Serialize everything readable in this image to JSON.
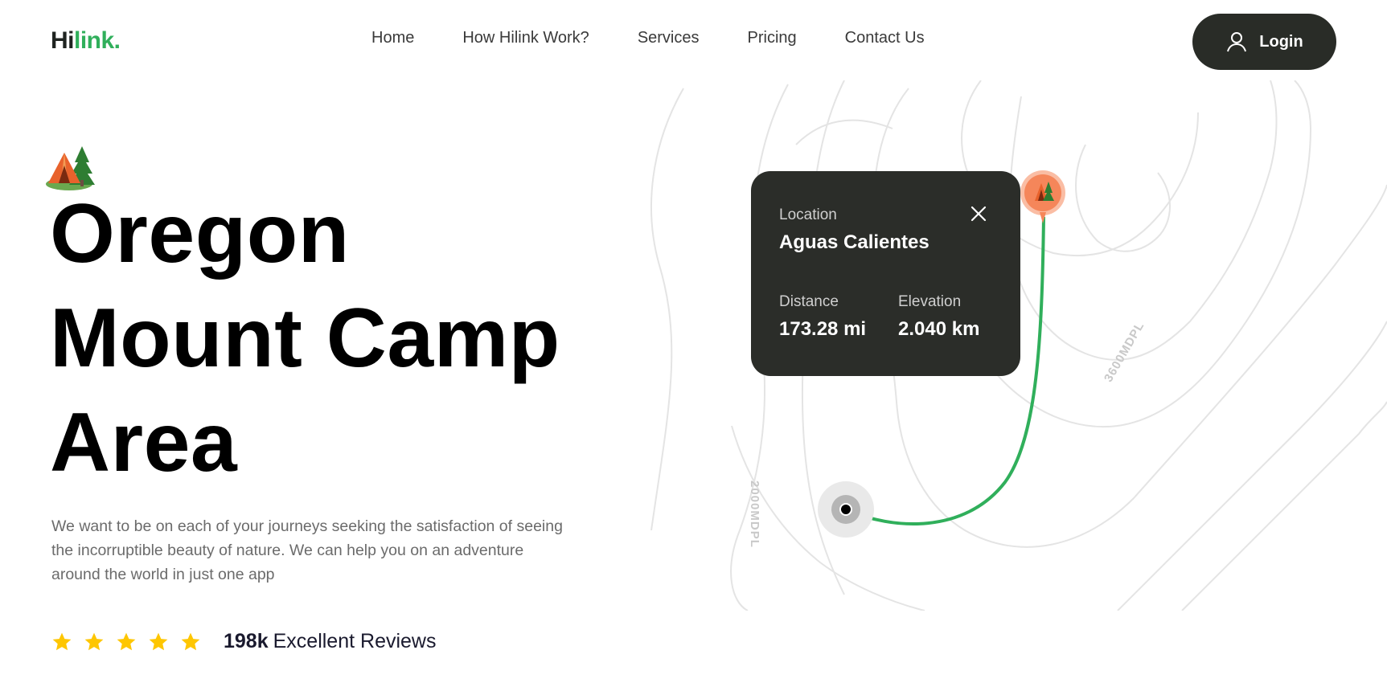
{
  "header": {
    "logo_part1": "Hi",
    "logo_part2": "link.",
    "nav": [
      "Home",
      "How Hilink Work?",
      "Services",
      "Pricing",
      "Contact Us"
    ],
    "login_label": "Login"
  },
  "hero": {
    "title_lines": [
      "Oregon",
      "Mount Camp",
      "Area"
    ],
    "description": "We want to be on each of your journeys seeking the satisfaction of seeing the incorruptible beauty of nature. We can help you on an adventure around the world in just one app",
    "rating": {
      "stars": 5,
      "count": "198k",
      "label": "Excellent Reviews"
    }
  },
  "map_card": {
    "location_label": "Location",
    "location_value": "Aguas Calientes",
    "distance_label": "Distance",
    "distance_value": "173.28 mi",
    "elevation_label": "Elevation",
    "elevation_value": "2.040 km"
  },
  "map": {
    "contour_label_left": "2000MDPL",
    "contour_label_right": "3600MDPL"
  },
  "colors": {
    "brand_green": "#30af5b",
    "dark": "#292c27",
    "star": "#fec601",
    "pin_orange": "#f5865a"
  },
  "icons": {
    "login": "user-icon",
    "camp": "camping-tent-icon",
    "close": "close-icon",
    "star": "star-icon",
    "pin": "map-pin-icon"
  }
}
